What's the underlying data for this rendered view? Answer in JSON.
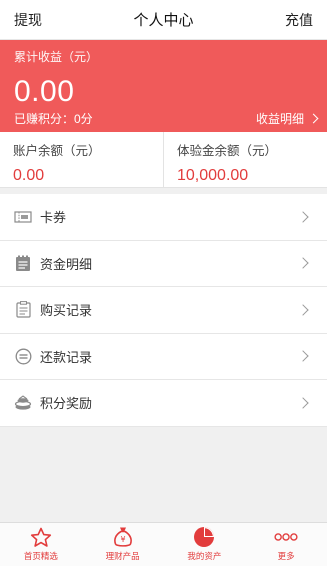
{
  "header": {
    "left": "提现",
    "title": "个人中心",
    "right": "充值"
  },
  "earnings": {
    "label": "累计收益（元）",
    "amount": "0.00",
    "points": "已赚积分：0分",
    "detail_link": "收益明细"
  },
  "balances": [
    {
      "label": "账户余额（元）",
      "value": "0.00"
    },
    {
      "label": "体验金余额（元）",
      "value": "10,000.00"
    }
  ],
  "menu": [
    {
      "label": "卡券",
      "icon": "coupon-icon"
    },
    {
      "label": "资金明细",
      "icon": "fund-detail-icon"
    },
    {
      "label": "购买记录",
      "icon": "purchase-record-icon"
    },
    {
      "label": "还款记录",
      "icon": "repayment-record-icon"
    },
    {
      "label": "积分奖励",
      "icon": "points-reward-icon"
    }
  ],
  "tabs": [
    {
      "label": "首页精选",
      "icon": "star-icon"
    },
    {
      "label": "理财产品",
      "icon": "money-bag-icon"
    },
    {
      "label": "我的资产",
      "icon": "pie-chart-icon",
      "active": true
    },
    {
      "label": "更多",
      "icon": "more-dots-icon"
    }
  ],
  "colors": {
    "accent": "#f05a5a",
    "value_red": "#e23c3c"
  }
}
